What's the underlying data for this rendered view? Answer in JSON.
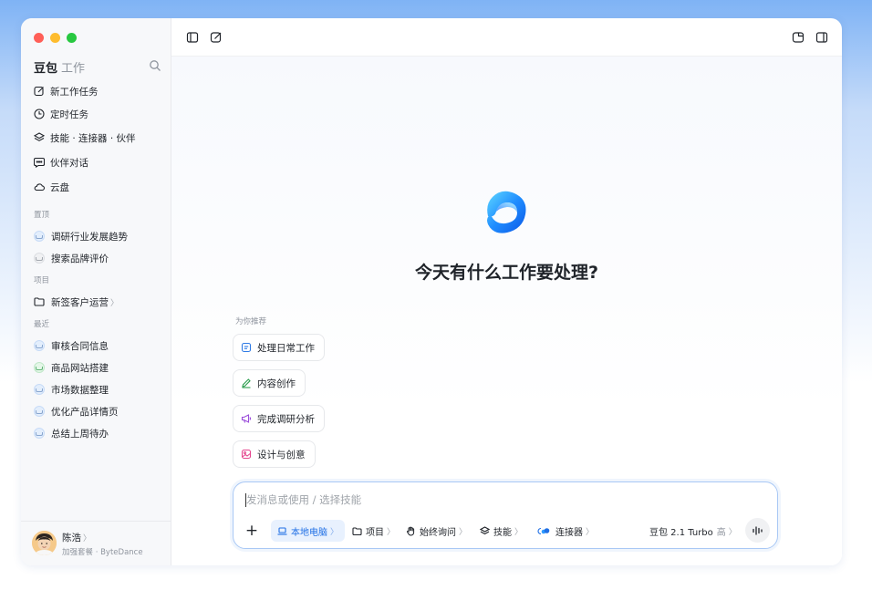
{
  "sidebar": {
    "brand": "豆包",
    "brand_sub": "工作",
    "nav": [
      {
        "label": "新工作任务",
        "icon": "edit-icon"
      },
      {
        "label": "定时任务",
        "icon": "clock-icon"
      },
      {
        "label": "技能 · 连接器 · 伙伴",
        "icon": "layers-icon"
      },
      {
        "label": "伙伴对话",
        "icon": "chat-icon"
      },
      {
        "label": "云盘",
        "icon": "cloud-icon"
      }
    ],
    "pinned_label": "置顶",
    "pinned": [
      "调研行业发展趋势",
      "搜索品牌评价"
    ],
    "projects_label": "项目",
    "projects": [
      {
        "label": "新签客户运营",
        "chevron": "〉"
      }
    ],
    "recent_label": "最近",
    "recent": [
      "审核合同信息",
      "商品网站搭建",
      "市场数据整理",
      "优化产品详情页",
      "总结上周待办"
    ],
    "user": {
      "name": "陈浩",
      "chevron": "〉",
      "plan": "加强套餐 · ByteDance"
    }
  },
  "main": {
    "heading": "今天有什么工作要处理?",
    "recommend_label": "为你推荐",
    "suggestions": [
      {
        "label": "处理日常工作",
        "icon": "document-icon",
        "color": "#2f7be5"
      },
      {
        "label": "内容创作",
        "icon": "pen-icon",
        "color": "#2e9e4f"
      },
      {
        "label": "完成调研分析",
        "icon": "megaphone-icon",
        "color": "#9b4ddb"
      },
      {
        "label": "设计与创意",
        "icon": "image-icon",
        "color": "#e5478f"
      }
    ]
  },
  "composer": {
    "placeholder": "发消息或使用 / 选择技能",
    "tools": [
      {
        "label": "本地电脑",
        "icon": "laptop-icon",
        "active": true
      },
      {
        "label": "项目",
        "icon": "folder-icon"
      },
      {
        "label": "始终询问",
        "icon": "hand-icon"
      },
      {
        "label": "技能",
        "icon": "layers-icon"
      },
      {
        "label": "连接器",
        "icon": "connector-icon"
      }
    ],
    "chevron": "〉",
    "model": "豆包 2.1 Turbo",
    "model_level": "高"
  },
  "colors": {
    "accent": "#1f6fe5",
    "composer_border": "#a9c8f5"
  }
}
